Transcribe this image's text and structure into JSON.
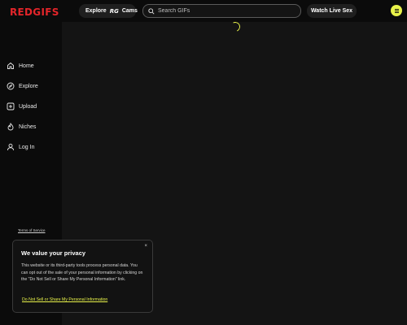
{
  "brand": {
    "logo_text": "REDGIFS",
    "logo_color": "#e4252a",
    "accent": "#e8f24a"
  },
  "header": {
    "explore_label": "Explore",
    "explore_rg": "RG",
    "explore_cams": "Cams",
    "search_placeholder": "Search GIFs",
    "live_label": "Watch Live Sex",
    "menu_icon": "hamburger-icon"
  },
  "sidebar": {
    "items": [
      {
        "label": "Home",
        "icon": "home-icon"
      },
      {
        "label": "Explore",
        "icon": "compass-icon"
      },
      {
        "label": "Upload",
        "icon": "upload-icon"
      },
      {
        "label": "Niches",
        "icon": "flame-icon"
      },
      {
        "label": "Log In",
        "icon": "user-icon"
      }
    ],
    "terms_label": "Terms of Service"
  },
  "privacy": {
    "title": "We value your privacy",
    "body": "This website or its third-party tools process personal data. You can opt out of the sale of your personal information by clicking on the \"Do Not Sell or Share My Personal Information\" link.",
    "link": "Do Not Sell or Share My Personal Information",
    "close": "×"
  }
}
